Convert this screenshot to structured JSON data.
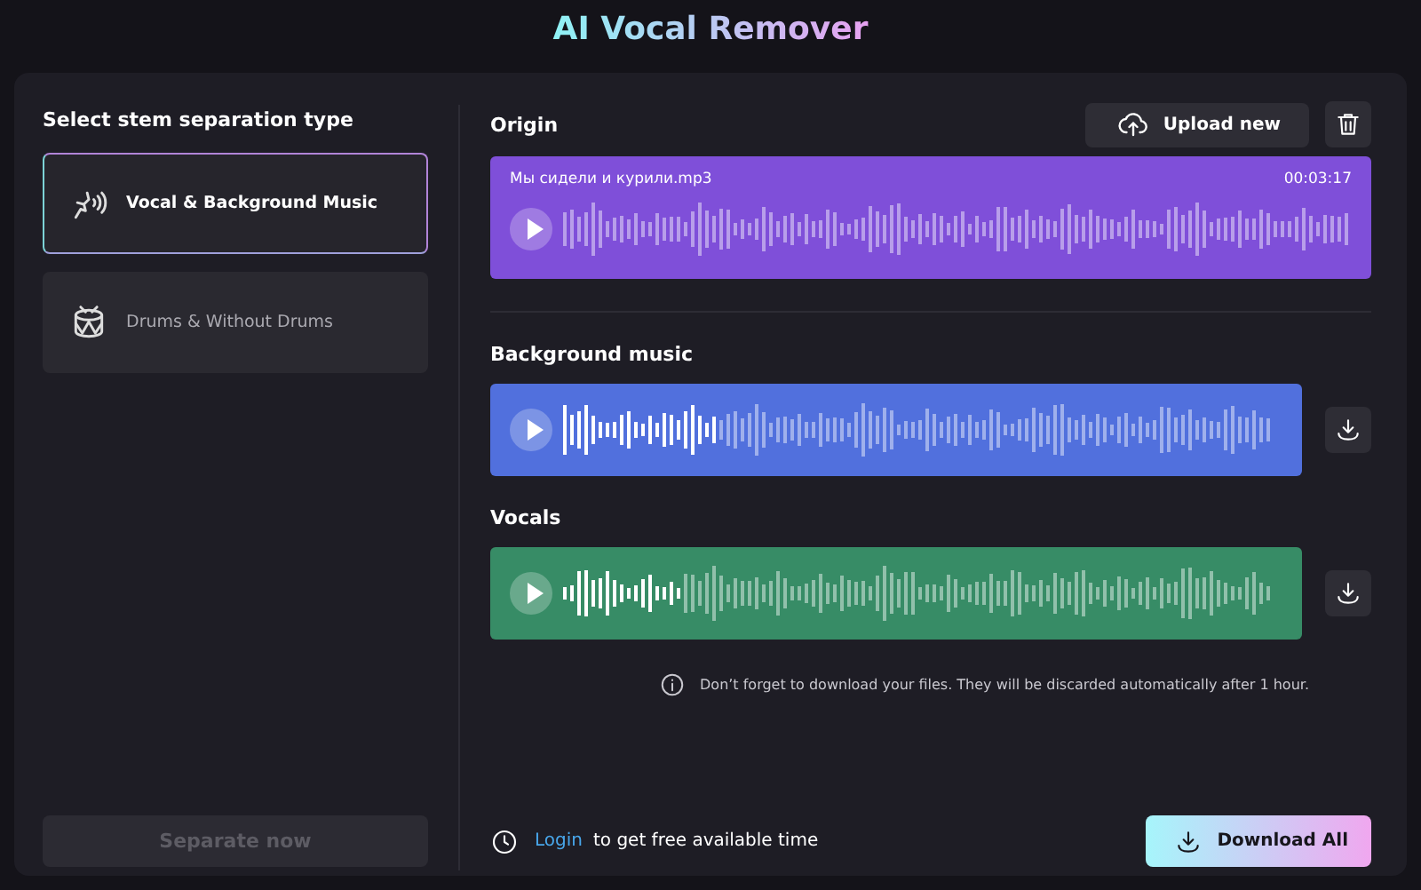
{
  "title": "AI Vocal Remover",
  "sidebar": {
    "heading": "Select stem separation type",
    "options": [
      {
        "kind": "vocal",
        "label": "Vocal & Background Music",
        "selected": true
      },
      {
        "kind": "drums",
        "label": "Drums & Without Drums",
        "selected": false
      }
    ],
    "separate_button": {
      "label": "Separate now",
      "disabled": true
    }
  },
  "origin": {
    "heading": "Origin",
    "upload_button": "Upload new",
    "file_name": "Мы сидели и курили.mp3",
    "duration": "00:03:17"
  },
  "stems": [
    {
      "heading": "Background music",
      "color": "#5170dd",
      "level": 0.22
    },
    {
      "heading": "Vocals",
      "color": "#378c66",
      "level": 0.17
    }
  ],
  "note": "Don’t forget to download your files. They will be discarded automatically after 1 hour.",
  "footer": {
    "login_link": "Login",
    "login_text": "to get free available time",
    "download_all": "Download All"
  }
}
